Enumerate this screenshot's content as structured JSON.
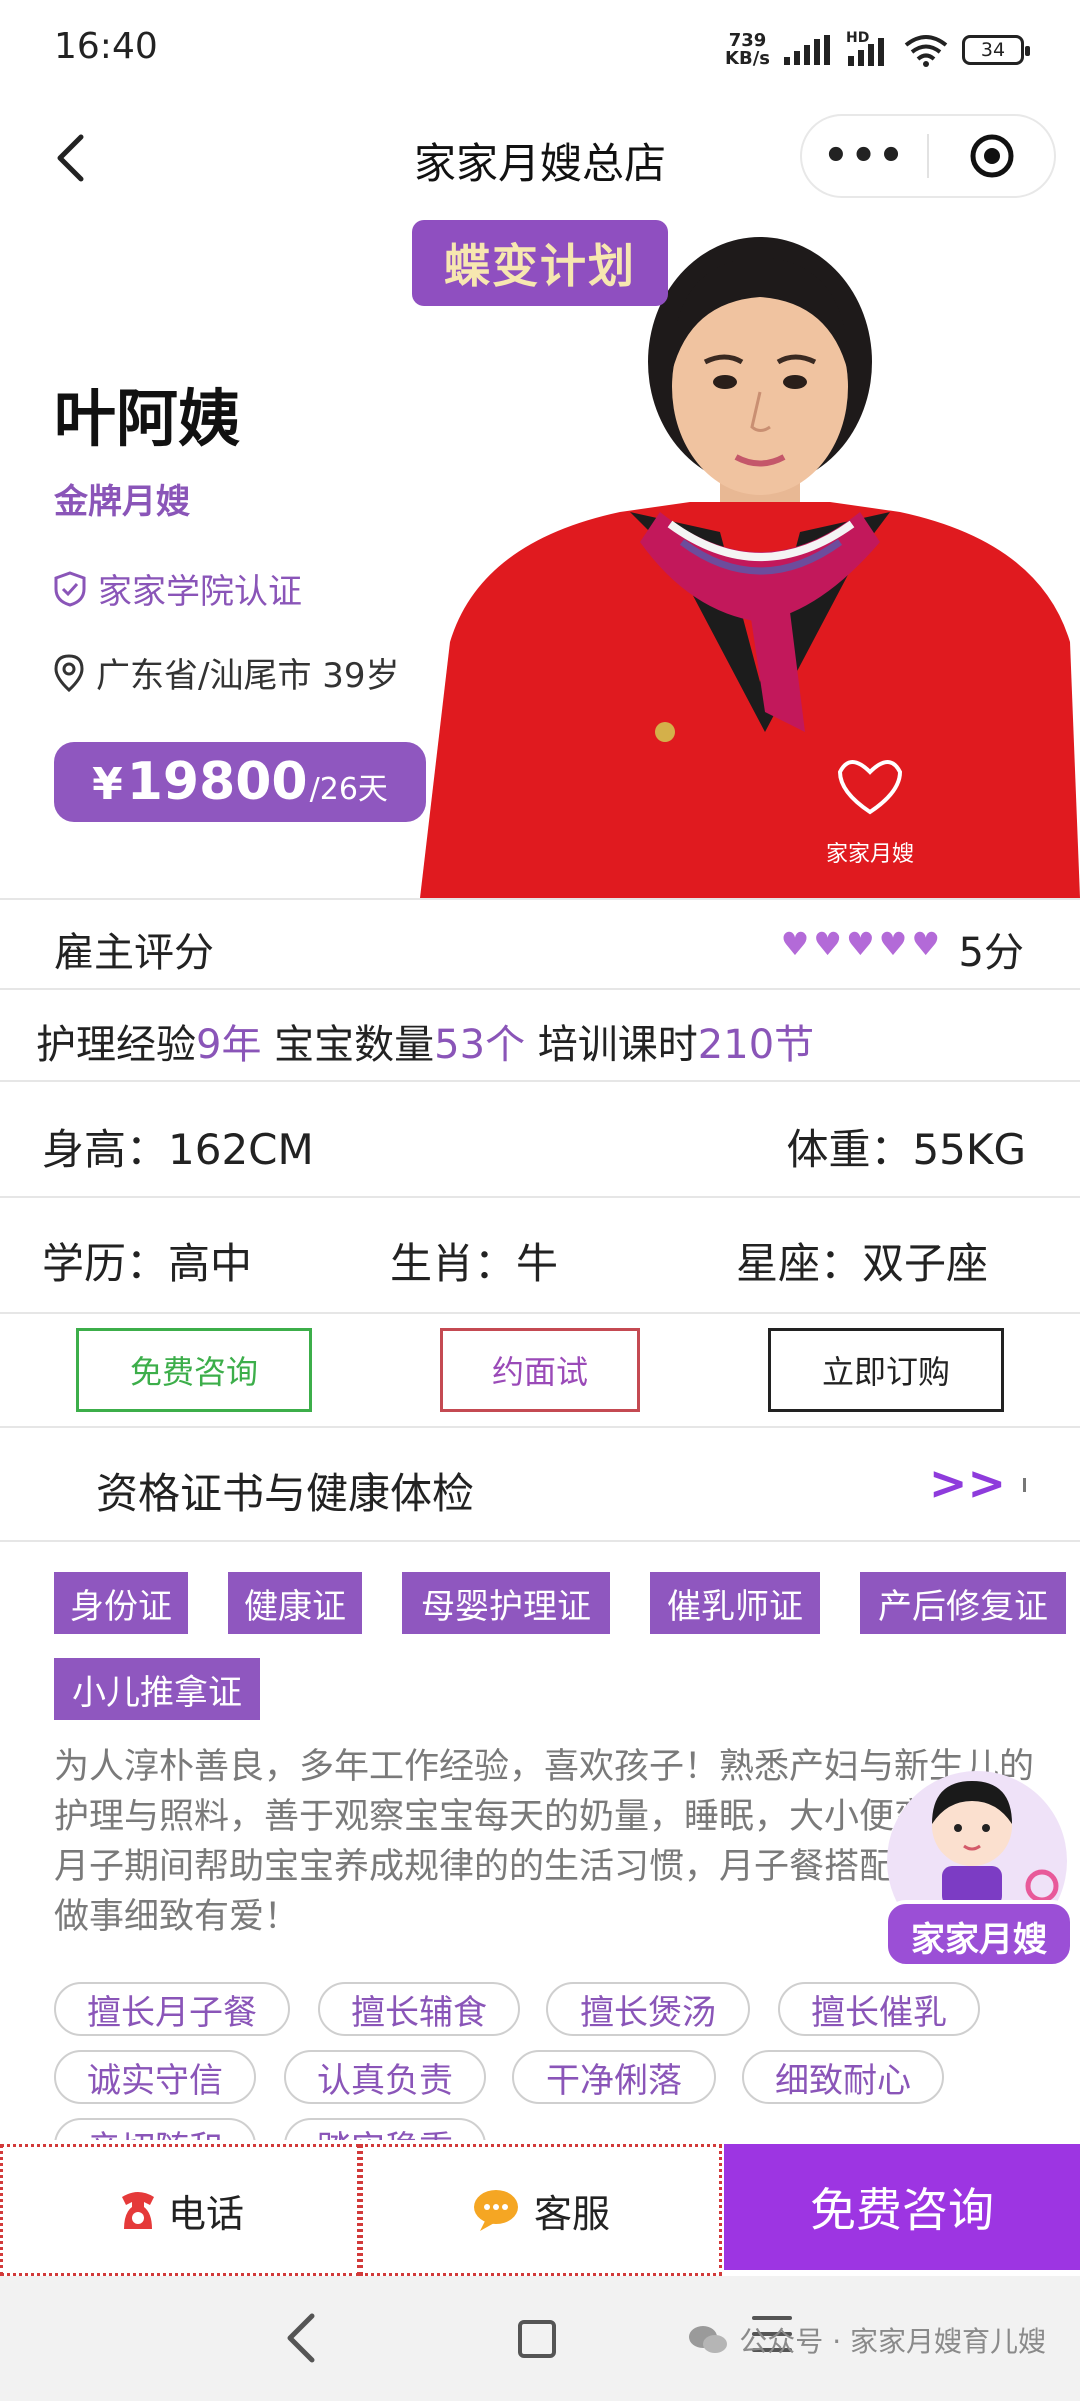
{
  "status_bar": {
    "time": "16:40",
    "net_speed_value": "739",
    "net_speed_unit": "KB/s",
    "hd_label": "HD",
    "battery": "34"
  },
  "header": {
    "title": "家家月嫂总店",
    "more_label": "•••"
  },
  "profile": {
    "banner_text": "蝶变计划",
    "name": "叶阿姨",
    "level": "金牌月嫂",
    "certification": "家家学院认证",
    "location_age": "广东省/汕尾市 39岁",
    "price_currency": "¥",
    "price_amount": "19800",
    "price_unit": "/26天",
    "uniform_brand": "家家月嫂"
  },
  "rating": {
    "label": "雇主评分",
    "hearts": 5,
    "score": "5分"
  },
  "experience": {
    "exp_label": "护理经验",
    "exp_value": "9年",
    "baby_label": "宝宝数量",
    "baby_value": "53个",
    "train_label": "培训课时",
    "train_value": "210节"
  },
  "body": {
    "height": "身高：162CM",
    "weight": "体重：55KG"
  },
  "info": {
    "education": "学历：高中",
    "zodiac": "生肖：牛",
    "constellation": "星座：双子座"
  },
  "actions": {
    "consult": "免费咨询",
    "interview": "约面试",
    "order": "立即订购"
  },
  "certificates": {
    "title": "资格证书与健康体检",
    "more": ">>",
    "tags": [
      "身份证",
      "健康证",
      "母婴护理证",
      "催乳师证",
      "产后修复证",
      "小儿推拿证"
    ]
  },
  "description": "为人淳朴善良，多年工作经验，喜欢孩子！熟悉产妇与新生儿的护理与照料，善于观察宝宝每天的奶量，睡眠，大小便变化，在月子期间帮助宝宝养成规律的的生活习惯，月子餐搭配与制作，做事细致有爱！",
  "skills": [
    "擅长月子餐",
    "擅长辅食",
    "擅长煲汤",
    "擅长催乳",
    "诚实守信",
    "认真负责",
    "干净俐落",
    "细致耐心",
    "亲切随和",
    "踏实稳重"
  ],
  "mascot": {
    "label": "家家月嫂"
  },
  "bottom_bar": {
    "phone": "电话",
    "service": "客服",
    "consult": "免费咨询"
  },
  "nav": {
    "watermark": "公众号 · 家家月嫂育儿嫂"
  },
  "colors": {
    "brand_purple": "#8f57bf",
    "cta_purple": "#9d35e2",
    "green": "#3cae4a",
    "red": "#c44a52"
  }
}
